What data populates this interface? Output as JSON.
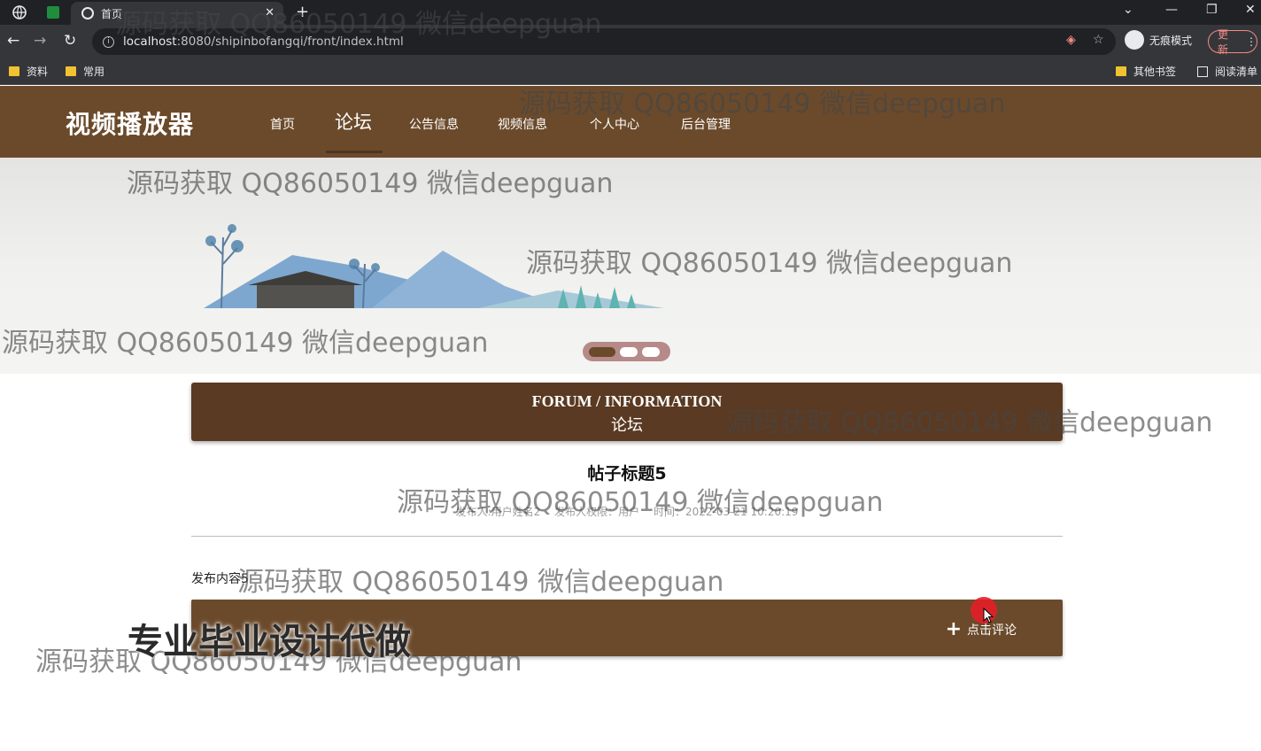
{
  "browser": {
    "tab_title": "首页",
    "new_tab": "+",
    "close_tab": "✕",
    "url_host": "localhost",
    "url_rest": ":8080/shipinbofangqi/front/index.html",
    "incognito_label": "无痕模式",
    "update_label": "更新",
    "bookmarks": [
      "资料",
      "常用"
    ],
    "bookmarks_right": [
      "其他书签",
      "阅读清单"
    ]
  },
  "site": {
    "brand": "视频播放器",
    "nav": [
      "首页",
      "论坛",
      "公告信息",
      "视频信息",
      "个人中心",
      "后台管理"
    ],
    "active_nav_index": 1
  },
  "banner": {
    "slide_count": 3,
    "active_slide": 0
  },
  "forum": {
    "title_en": "FORUM / INFORMATION",
    "title_zh": "论坛"
  },
  "post": {
    "title": "帖子标题5",
    "author": "发布人:用户姓名2",
    "role": "发布人权限：用户",
    "time": "时间：2022-03-21 10:20:19",
    "content": "发布内容5"
  },
  "comment": {
    "button_label": "点击评论"
  },
  "watermark": {
    "text": "源码获取 QQ86050149 微信deepguan",
    "promo": "专业毕业设计代做"
  },
  "colors": {
    "header_brown": "#6b4a2b",
    "panel_brown": "#5a3a22"
  }
}
